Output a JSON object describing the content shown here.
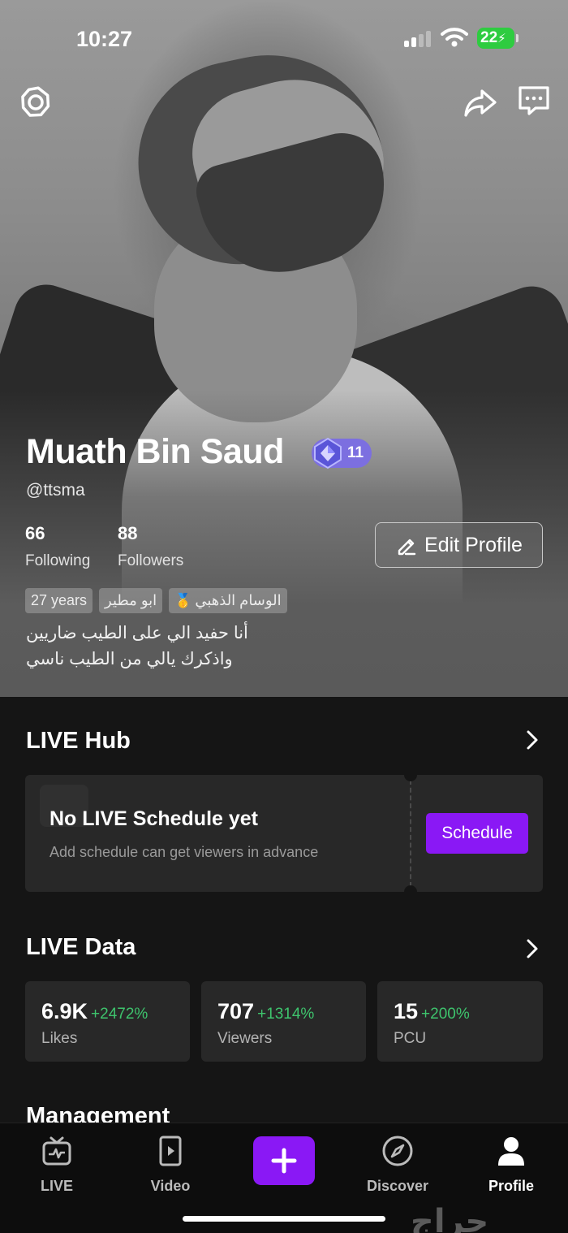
{
  "status_bar": {
    "time": "10:27",
    "battery": "22"
  },
  "profile": {
    "name": "Muath Bin Saud",
    "level": "11",
    "handle": "@ttsma",
    "following_count": "66",
    "following_label": "Following",
    "followers_count": "88",
    "followers_label": "Followers",
    "edit_label": "Edit Profile",
    "tags": [
      "27 years",
      "ابو مطير",
      "الوسام الذهبي"
    ],
    "bio_line1": "أنا حفيد الي على الطيب ضاريين",
    "bio_line2": "واذكرك يالي من الطيب ناسي"
  },
  "live_hub": {
    "title": "LIVE Hub",
    "card_title": "No LIVE Schedule yet",
    "card_subtitle": "Add schedule can get viewers in advance",
    "schedule_label": "Schedule"
  },
  "live_data": {
    "title": "LIVE Data",
    "cards": [
      {
        "value": "6.9K",
        "change": "+2472%",
        "label": "Likes"
      },
      {
        "value": "707",
        "change": "+1314%",
        "label": "Viewers"
      },
      {
        "value": "15",
        "change": "+200%",
        "label": "PCU"
      }
    ]
  },
  "management": {
    "title": "Management"
  },
  "tabbar": {
    "live": "LIVE",
    "video": "Video",
    "discover": "Discover",
    "profile": "Profile"
  },
  "watermark": "حراج",
  "colors": {
    "accent": "#8a18f5",
    "positive": "#3ec46d",
    "battery": "#2ecc40"
  },
  "icons": [
    "settings-icon",
    "share-icon",
    "message-icon",
    "edit-icon",
    "chevron-right-icon",
    "live-icon",
    "video-icon",
    "plus-icon",
    "compass-icon",
    "profile-icon"
  ]
}
